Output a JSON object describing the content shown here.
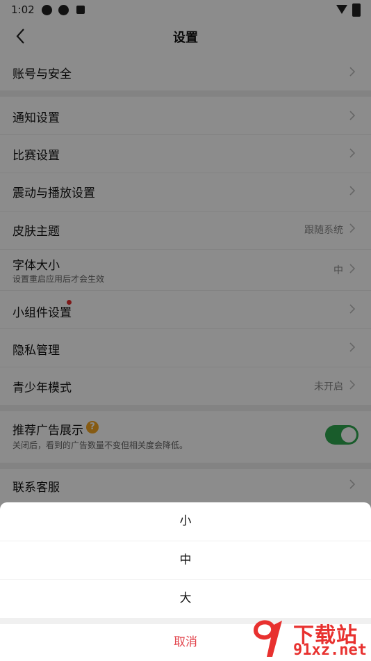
{
  "status_bar": {
    "time": "1:02"
  },
  "header": {
    "title": "设置"
  },
  "settings": {
    "account": {
      "label": "账号与安全"
    },
    "notify": {
      "label": "通知设置"
    },
    "match": {
      "label": "比赛设置"
    },
    "vibration": {
      "label": "震动与播放设置"
    },
    "skin": {
      "label": "皮肤主题",
      "value": "跟随系统"
    },
    "font": {
      "label": "字体大小",
      "sub": "设置重启应用后才会生效",
      "value": "中"
    },
    "widget": {
      "label": "小组件设置"
    },
    "privacy": {
      "label": "隐私管理"
    },
    "teen": {
      "label": "青少年模式",
      "value": "未开启"
    },
    "ads": {
      "label": "推荐广告展示",
      "sub": "关闭后，看到的广告数量不变但相关度会降低。",
      "help": "?",
      "enabled": true
    },
    "service": {
      "label": "联系客服"
    }
  },
  "sheet": {
    "options": [
      "小",
      "中",
      "大"
    ],
    "cancel": "取消"
  },
  "watermark": {
    "line1": "下载站",
    "line2": "91xz.net"
  },
  "colors": {
    "toggle_on": "#2fa84f",
    "cancel": "#e2434b",
    "badge": "#e62e2e",
    "help": "#f5a623",
    "watermark": "#e8312f"
  }
}
